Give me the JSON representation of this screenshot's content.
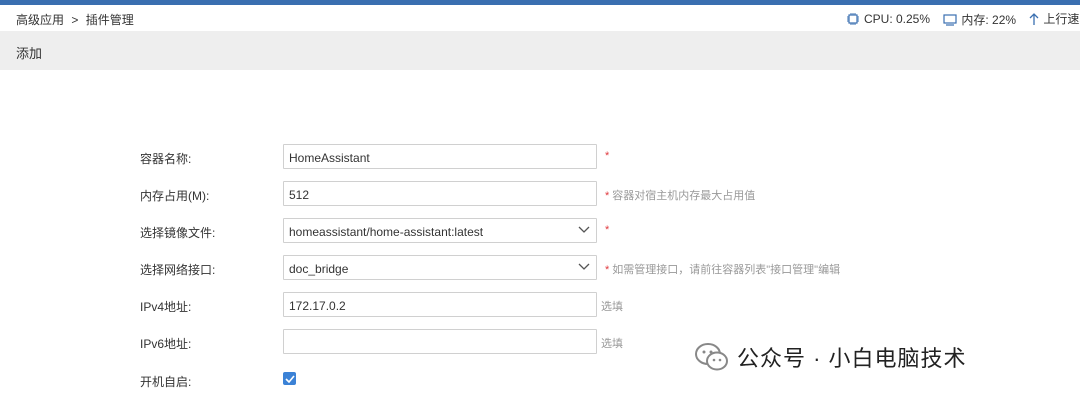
{
  "breadcrumb": {
    "parent": "高级应用",
    "separator": ">",
    "current": "插件管理"
  },
  "stats": {
    "cpu": "CPU: 0.25%",
    "mem": "内存: 22%",
    "upload": "上行速率"
  },
  "subbar": {
    "title": "添加"
  },
  "form": {
    "name": {
      "label": "容器名称:",
      "value": "HomeAssistant",
      "hint": "*"
    },
    "memory": {
      "label": "内存占用(M):",
      "value": "512",
      "hint_star": "*",
      "hint": "容器对宿主机内存最大占用值"
    },
    "image": {
      "label": "选择镜像文件:",
      "value": "homeassistant/home-assistant:latest",
      "hint": "*"
    },
    "network": {
      "label": "选择网络接口:",
      "value": "doc_bridge",
      "hint_star": "*",
      "hint": "如需管理接口，请前往容器列表\"接口管理\"编辑"
    },
    "ipv4": {
      "label": "IPv4地址:",
      "value": "172.17.0.2",
      "hint": "选填"
    },
    "ipv6": {
      "label": "IPv6地址:",
      "value": "",
      "hint": "选填"
    },
    "autostart": {
      "label": "开机自启:",
      "checked": true
    }
  },
  "watermark": {
    "text": "公众号 · 小白电脑技术"
  },
  "colors": {
    "accent": "#3a6fb0",
    "required": "#e0393e",
    "checkbox": "#3b82d6"
  }
}
